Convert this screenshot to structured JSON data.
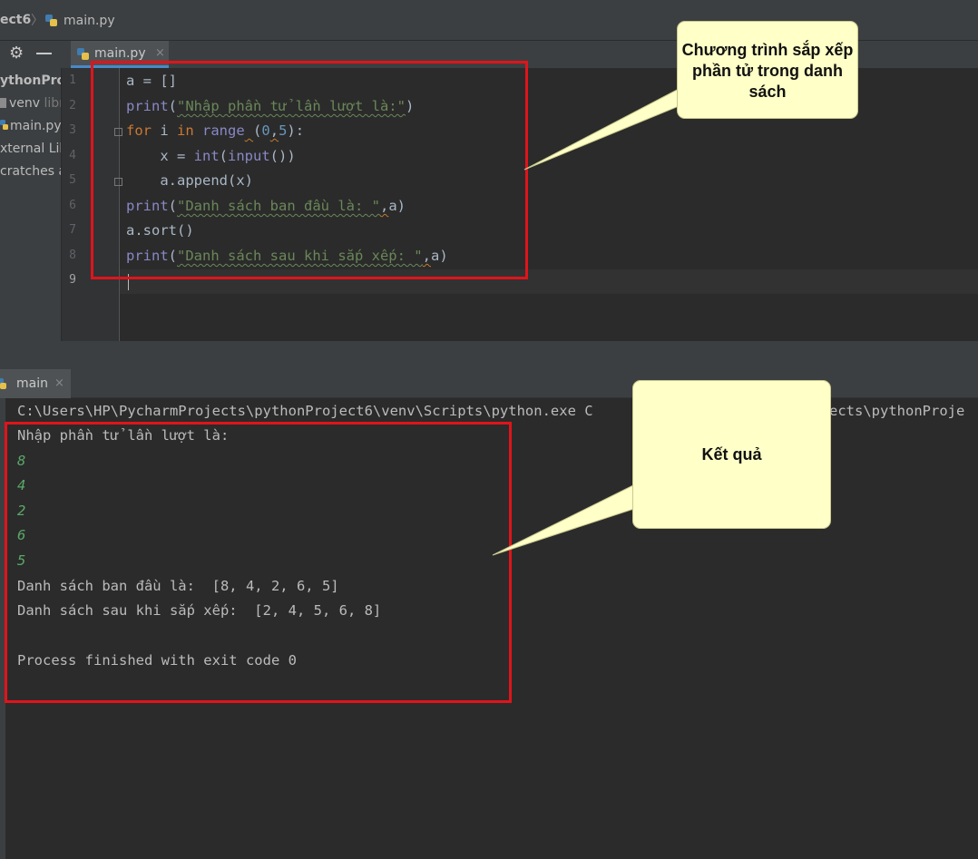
{
  "breadcrumb": {
    "project": "ect6",
    "file": "main.py"
  },
  "editor_tab": {
    "label": "main.py",
    "close": "×"
  },
  "project_tree": [
    {
      "label": "ythonProj",
      "dim": ""
    },
    {
      "label": "venv",
      "dim": "libr"
    },
    {
      "label": "main.py",
      "dim": ""
    },
    {
      "label": "xternal Libr",
      "dim": ""
    },
    {
      "label": "cratches an",
      "dim": ""
    }
  ],
  "line_numbers": [
    "1",
    "2",
    "3",
    "4",
    "5",
    "6",
    "7",
    "8",
    "9"
  ],
  "code": {
    "l1": "a = []",
    "l2_fn": "print",
    "l2_str": "\"Nhập phần tử lần lượt là:\"",
    "l3_kw1": "for",
    "l3_var": " i ",
    "l3_kw2": "in",
    "l3_fn": "range",
    "l3_n1": "0",
    "l3_n2": "5",
    "l4_a": "x = ",
    "l4_fn1": "int",
    "l4_fn2": "input",
    "l5": "a.append(x)",
    "l6_fn": "print",
    "l6_str": "\"Danh sách ban đầu là: \"",
    "l7": "a.sort()",
    "l8_fn": "print",
    "l8_str": "\"Danh sách sau khi sắp xếp: \""
  },
  "run_tab": {
    "label": "main",
    "close": "×"
  },
  "console": {
    "command": "C:\\Users\\HP\\PycharmProjects\\pythonProject6\\venv\\Scripts\\python.exe C",
    "command_tail": "ects\\pythonProje",
    "prompt": "Nhập phần tử lần lượt là:",
    "inputs": [
      "8",
      "4",
      "2",
      "6",
      "5"
    ],
    "original": "Danh sách ban đầu là:  [8, 4, 2, 6, 5]",
    "sorted": "Danh sách sau khi sắp xếp:  [2, 4, 5, 6, 8]",
    "exit": "Process finished with exit code 0"
  },
  "callouts": {
    "program": "Chương trình sắp xếp phần tử trong danh sách",
    "result": "Kết quả"
  },
  "colors": {
    "highlight": "#e0141b",
    "callout_bg": "#ffffc8",
    "tab_underline": "#4a88c7"
  }
}
